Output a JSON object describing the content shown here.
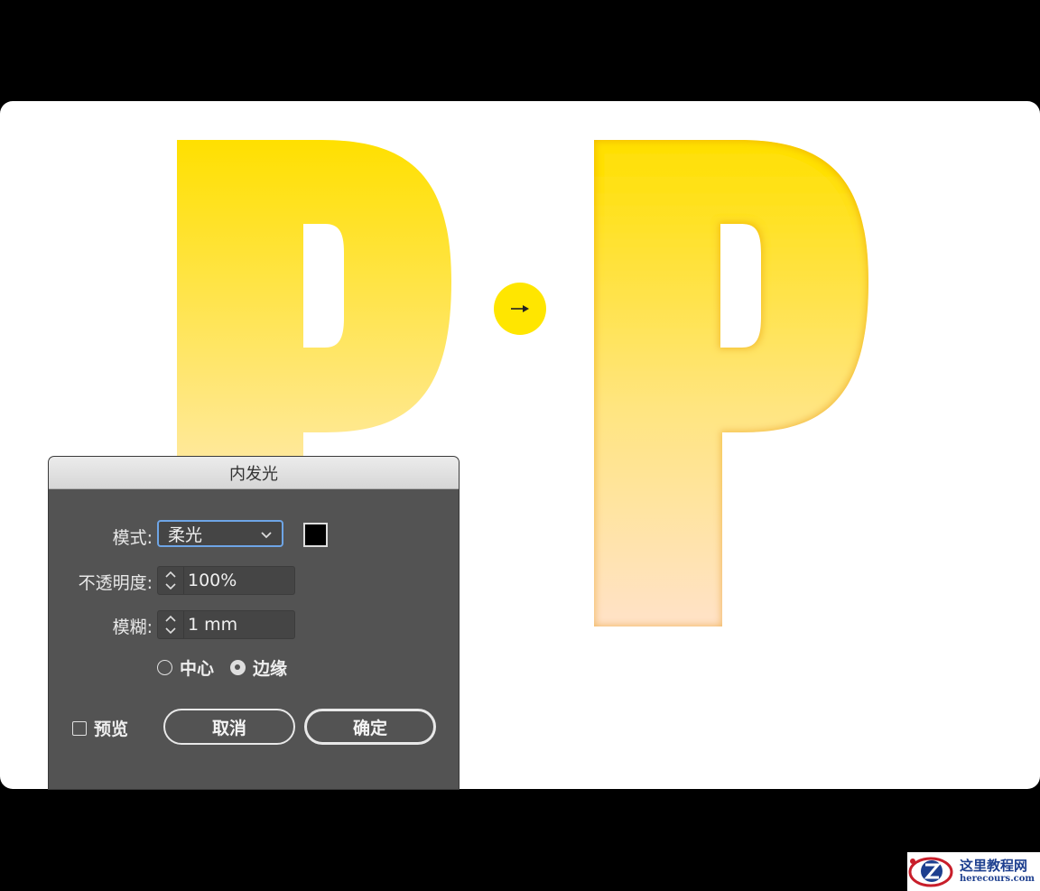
{
  "dialog": {
    "title": "内发光",
    "mode_label": "模式:",
    "mode_value": "柔光",
    "opacity_label": "不透明度:",
    "opacity_value": "100%",
    "blur_label": "模糊:",
    "blur_value": "1 mm",
    "radio_center": "中心",
    "radio_edge": "边缘",
    "selected_radio": "边缘",
    "preview_label": "预览",
    "preview_checked": false,
    "cancel_label": "取消",
    "ok_label": "确定",
    "swatch_color": "#000000"
  },
  "artwork": {
    "letter_before": "P",
    "letter_after": "P",
    "gradient_top": "#FFE000",
    "gradient_bottom_before": "#FFE9A0",
    "gradient_bottom_after": "#FFE0C8",
    "inner_glow_color": "#F5B800",
    "arrow_circle_color": "#FFE600",
    "arrow_icon": "arrow-right-icon"
  },
  "watermark": {
    "line1": "这里教程网",
    "line2": "herecours.com"
  }
}
